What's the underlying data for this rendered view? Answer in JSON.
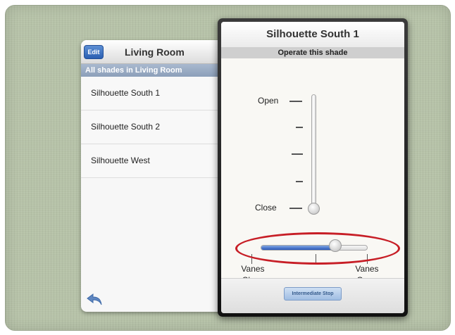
{
  "left_panel": {
    "edit_label": "Edit",
    "title": "Living Room",
    "section_header": "All shades in Living Room",
    "items": [
      {
        "label": "Silhouette South 1"
      },
      {
        "label": "Silhouette South 2"
      },
      {
        "label": "Silhouette West"
      }
    ],
    "back_icon": "undo-arrow-icon"
  },
  "popover": {
    "title": "Silhouette South 1",
    "subtitle": "Operate this shade",
    "vertical_slider": {
      "open_label": "Open",
      "close_label": "Close",
      "value": 0.0
    },
    "vane_slider": {
      "close_label_1": "Vanes",
      "close_label_2": "Close",
      "open_label_1": "Vanes",
      "open_label_2": "Open",
      "value": 0.7
    },
    "intermediate_stop_label": "Intermediate Stop"
  },
  "colors": {
    "accent_blue": "#2a5fb2",
    "highlight_red": "#c71e26",
    "background_green": "#b6c2a8"
  }
}
